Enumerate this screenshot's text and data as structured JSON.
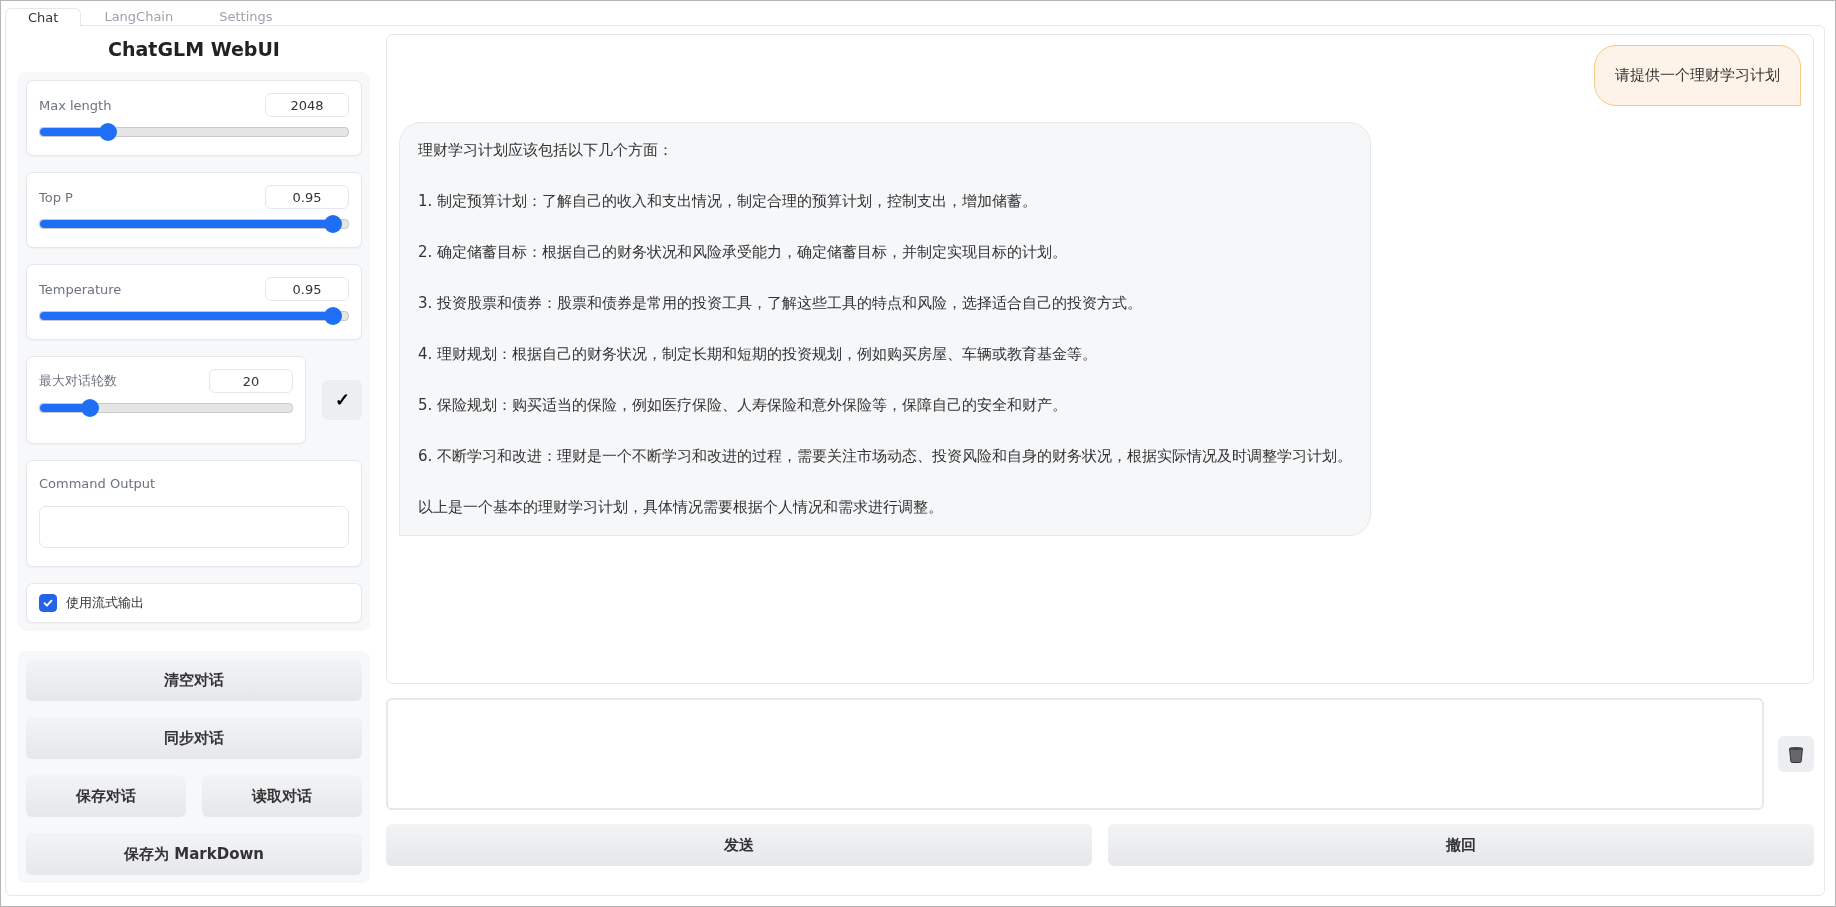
{
  "tabs": [
    {
      "label": "Chat",
      "selected": true
    },
    {
      "label": "LangChain",
      "selected": false
    },
    {
      "label": "Settings",
      "selected": false
    }
  ],
  "title": "ChatGLM WebUI",
  "sliders": [
    {
      "label": "Max length",
      "value": "2048",
      "level": 0.22
    },
    {
      "label": "Top P",
      "value": "0.95",
      "level": 0.95
    },
    {
      "label": "Temperature",
      "value": "0.95",
      "level": 0.95
    }
  ],
  "dialog_rounds": {
    "label": "最大对话轮数",
    "value": "20",
    "level": 0.2
  },
  "confirm_button": "✓",
  "command_output": {
    "label": "Command Output"
  },
  "stream_checkbox": {
    "label": "使用流式输出",
    "checked": true
  },
  "button_rows": [
    [
      "清空对话"
    ],
    [
      "同步对话"
    ],
    [
      "保存对话",
      "读取对话"
    ],
    [
      "保存为 MarkDown"
    ]
  ],
  "messages": [
    {
      "kind": "user",
      "paragraphs": [
        "请提供一个理财学习计划"
      ]
    },
    {
      "kind": "assistant",
      "paragraphs": [
        "理财学习计划应该包括以下几个方面：",
        "1. 制定预算计划：了解自己的收入和支出情况，制定合理的预算计划，控制支出，增加储蓄。",
        "2. 确定储蓄目标：根据自己的财务状况和风险承受能力，确定储蓄目标，并制定实现目标的计划。",
        "3. 投资股票和债券：股票和债券是常用的投资工具，了解这些工具的特点和风险，选择适合自己的投资方式。",
        "4. 理财规划：根据自己的财务状况，制定长期和短期的投资规划，例如购买房屋、车辆或教育基金等。",
        "5. 保险规划：购买适当的保险，例如医疗保险、人寿保险和意外保险等，保障自己的安全和财产。",
        "6. 不断学习和改进：理财是一个不断学习和改进的过程，需要关注市场动态、投资风险和自身的财务状况，根据实际情况及时调整学习计划。",
        "以上是一个基本的理财学习计划，具体情况需要根据个人情况和需求进行调整。"
      ]
    }
  ],
  "actions": [
    "发送",
    "撤回"
  ]
}
